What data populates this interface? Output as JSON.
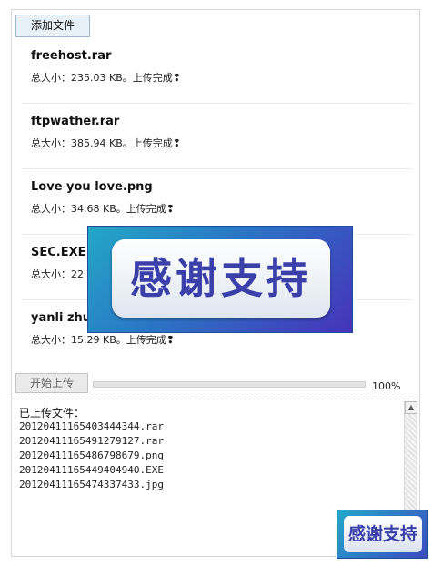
{
  "toolbar": {
    "add_files_label": "添加文件"
  },
  "files": [
    {
      "name": "freehost.rar",
      "status": "总大小：235.03 KB。上传完成❢"
    },
    {
      "name": "ftpwather.rar",
      "status": "总大小：385.94 KB。上传完成❢"
    },
    {
      "name": "Love you love.png",
      "status": "总大小：34.68 KB。上传完成❢"
    },
    {
      "name": "SEC.EXE",
      "status": "总大小：22"
    },
    {
      "name": "yanli zhu",
      "status": "总大小：15.29 KB。上传完成❢"
    }
  ],
  "promo": {
    "text": "感谢支持",
    "small_text": "感谢支持"
  },
  "upload": {
    "start_label": "开始上传",
    "progress_percent": 100,
    "progress_text": "100%"
  },
  "log": {
    "title": "已上传文件：",
    "lines": [
      "20120411165403444344.rar",
      "20120411165491279127.rar",
      "20120411165486798679.png",
      "2012041116544940494O.EXE",
      "20120411165474337433.jpg"
    ]
  },
  "scroll": {
    "up_glyph": "▲"
  }
}
